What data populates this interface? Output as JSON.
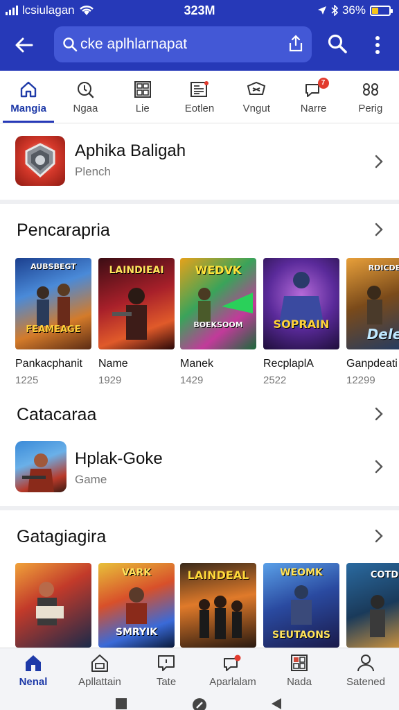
{
  "status_bar": {
    "carrier": "lcsiulagan",
    "time": "323M",
    "battery": "36%",
    "battery_level": 0.36
  },
  "search": {
    "value": "cke aplhlarnapat",
    "placeholder": ""
  },
  "category_tabs": [
    {
      "label": "Mangia",
      "icon": "home-outline-icon",
      "active": true
    },
    {
      "label": "Ngaa",
      "icon": "compass-icon"
    },
    {
      "label": "Lie",
      "icon": "grid-icon"
    },
    {
      "label": "Eotlen",
      "icon": "news-icon"
    },
    {
      "label": "Vngut",
      "icon": "tag-icon"
    },
    {
      "label": "Narre",
      "icon": "chat-bubble-icon",
      "badge": "7"
    },
    {
      "label": "Perig",
      "icon": "links-icon"
    }
  ],
  "featured": {
    "title": "Aphika Baligah",
    "subtitle": "Plench",
    "icon": "shield-game-icon"
  },
  "section1": {
    "title": "Pencarapria",
    "items": [
      {
        "name": "Pankacphanit",
        "value": "1225",
        "caption": "FEAMEAGE",
        "header": "AUBSBEGT"
      },
      {
        "name": "Name",
        "value": "1929",
        "caption": "",
        "header": "LAINDIEAI"
      },
      {
        "name": "Manek",
        "value": "1429",
        "caption": "BOEKSOOM",
        "header": "WEDVK"
      },
      {
        "name": "RecplaplA",
        "value": "2522",
        "caption": "SOPRAIN",
        "header": ""
      },
      {
        "name": "Ganpdeati",
        "value": "12299",
        "caption": "Dele",
        "header": "RDICDE"
      }
    ]
  },
  "section2": {
    "title": "Catacaraa",
    "app": {
      "title": "Hplak-Goke",
      "subtitle": "Game",
      "icon": "soldier-game-icon"
    }
  },
  "section3": {
    "title": "Gatagiagira",
    "items": [
      {
        "caption": "",
        "header": ""
      },
      {
        "caption": "SMRYIK",
        "header": "VARK"
      },
      {
        "caption": "",
        "header": "LAINDEAL"
      },
      {
        "caption": "SEUTAONS",
        "header": "WEOMK"
      },
      {
        "caption": "",
        "header": "COTD"
      }
    ]
  },
  "bottom_nav": [
    {
      "label": "Nenal",
      "icon": "home-icon",
      "active": true
    },
    {
      "label": "Apllattain",
      "icon": "house-outline-icon"
    },
    {
      "label": "Tate",
      "icon": "message-square-icon"
    },
    {
      "label": "Aparlalam",
      "icon": "chat-notify-icon"
    },
    {
      "label": "Nada",
      "icon": "grid-apps-icon"
    },
    {
      "label": "Satened",
      "icon": "user-icon"
    }
  ],
  "colors": {
    "header": "#2639b8",
    "search_bg": "#4358d6",
    "accent": "#1e3aa8"
  }
}
